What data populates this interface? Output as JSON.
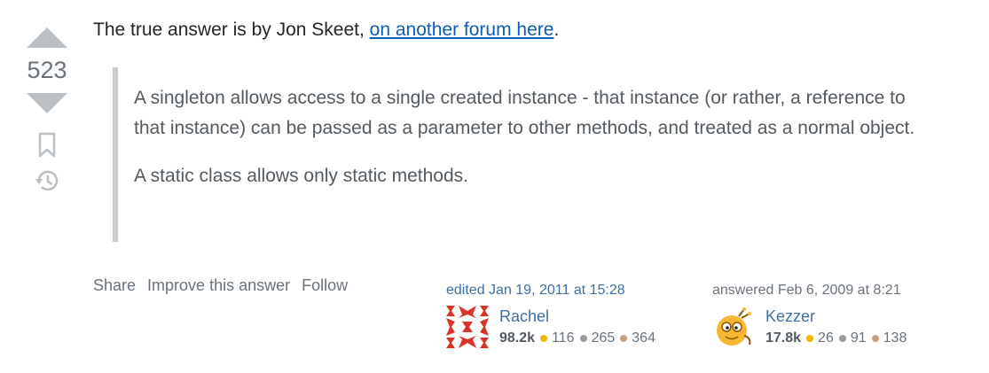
{
  "vote": {
    "score": "523"
  },
  "answer": {
    "intro_text": "The true answer is by Jon Skeet, ",
    "intro_link": "on another forum here",
    "intro_end": ".",
    "quote_paragraphs": [
      "A singleton allows access to a single created instance - that instance (or rather, a reference to that instance) can be passed as a parameter to other methods, and treated as a normal object.",
      "A static class allows only static methods."
    ]
  },
  "menu": {
    "share": "Share",
    "improve": "Improve this answer",
    "follow": "Follow"
  },
  "edited": {
    "action": "edited Jan 19, 2011 at 15:28",
    "user": "Rachel",
    "reputation": "98.2k",
    "gold": "116",
    "silver": "265",
    "bronze": "364"
  },
  "owner": {
    "action": "answered Feb 6, 2009 at 8:21",
    "user": "Kezzer",
    "reputation": "17.8k",
    "gold": "26",
    "silver": "91",
    "bronze": "138"
  },
  "colors": {
    "link": "#0c5db8",
    "user_link": "#3f6ea3",
    "muted": "#6a737c",
    "gold": "#f1b600",
    "silver": "#9a9c9f",
    "bronze": "#c8a082"
  },
  "icons": [
    "upvote-icon",
    "downvote-icon",
    "bookmark-icon",
    "history-icon"
  ]
}
